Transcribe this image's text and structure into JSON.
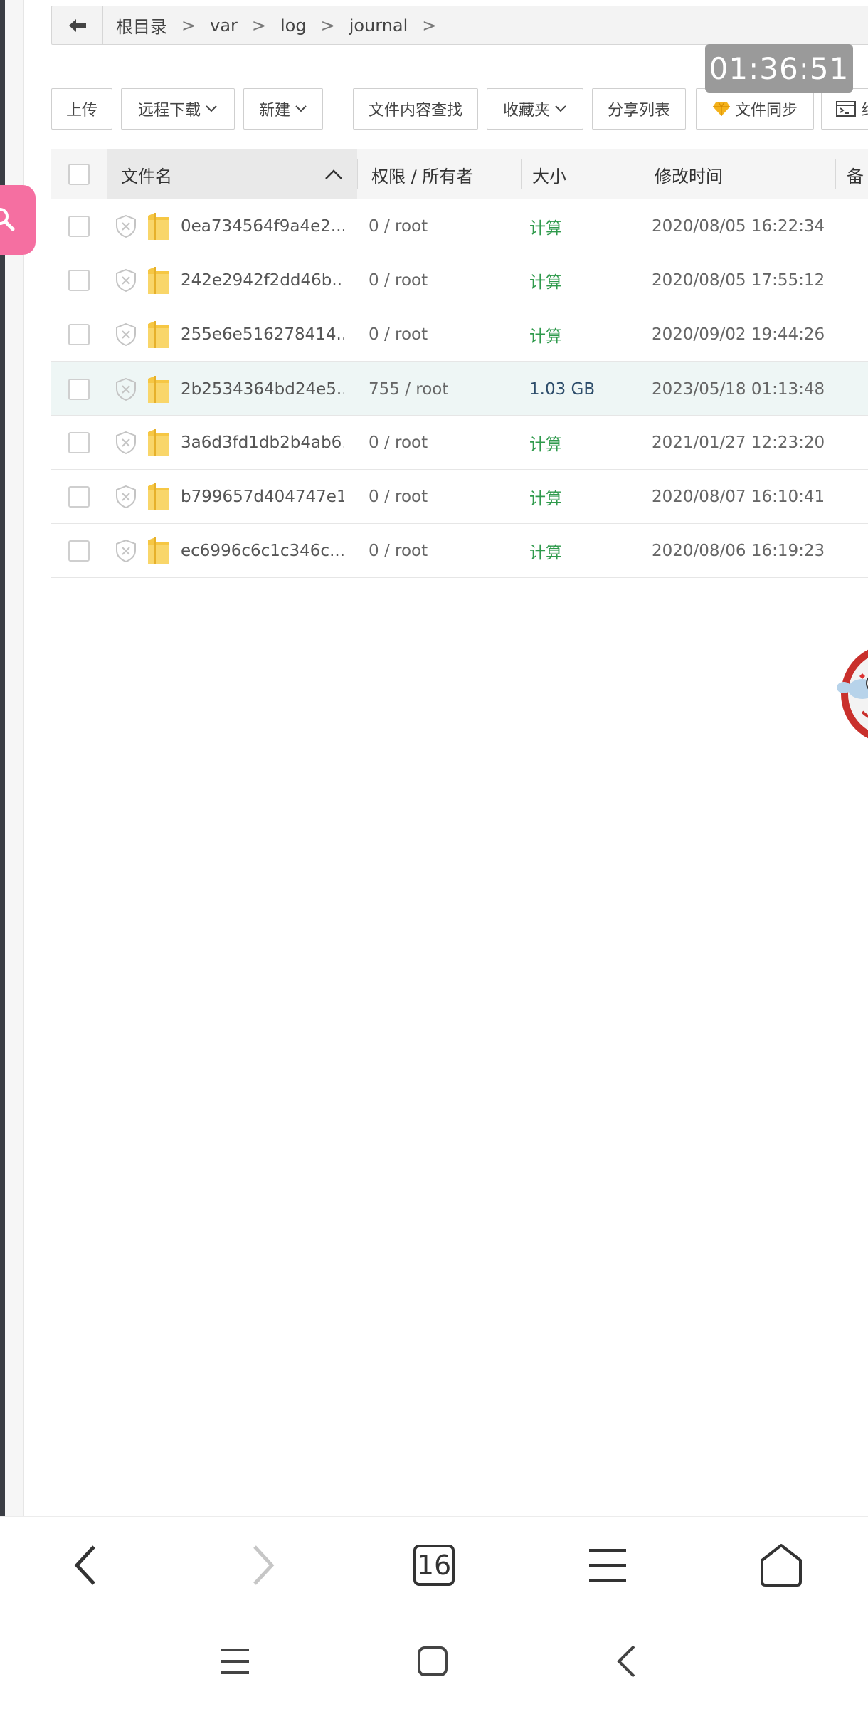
{
  "breadcrumb": {
    "items": [
      "根目录",
      "var",
      "log",
      "journal"
    ],
    "separator": ">"
  },
  "clock": "01:36:51",
  "toolbar": {
    "upload": "上传",
    "remote_download": "远程下载",
    "new": "新建",
    "content_search": "文件内容查找",
    "favorites": "收藏夹",
    "share_list": "分享列表",
    "file_sync": "文件同步",
    "terminal": "终端"
  },
  "table": {
    "headers": {
      "name": "文件名",
      "perm_owner": "权限 / 所有者",
      "size": "大小",
      "mtime": "修改时间",
      "remark": "备"
    },
    "rows": [
      {
        "name": "0ea734564f9a4e2...",
        "perm": "0 / root",
        "size": "计算",
        "mtime": "2020/08/05 16:22:34"
      },
      {
        "name": "242e2942f2dd46b...",
        "perm": "0 / root",
        "size": "计算",
        "mtime": "2020/08/05 17:55:12"
      },
      {
        "name": "255e6e516278414...",
        "perm": "0 / root",
        "size": "计算",
        "mtime": "2020/09/02 19:44:26"
      },
      {
        "name": "2b2534364bd24e5...",
        "perm": "755 / root",
        "size": "1.03 GB",
        "mtime": "2023/05/18 01:13:48"
      },
      {
        "name": "3a6d3fd1db2b4ab6...",
        "perm": "0 / root",
        "size": "计算",
        "mtime": "2021/01/27 12:23:20"
      },
      {
        "name": "b799657d404747e1...",
        "perm": "0 / root",
        "size": "计算",
        "mtime": "2020/08/07 16:10:41"
      },
      {
        "name": "ec6996c6c1c346c...",
        "perm": "0 / root",
        "size": "计算",
        "mtime": "2020/08/06 16:19:23"
      }
    ]
  },
  "browser_nav": {
    "tab_count": "16"
  },
  "icons": {
    "back": "arrow-left-icon",
    "folder": "folder-icon",
    "shield": "shield-icon",
    "diamond": "diamond-icon",
    "terminal": "terminal-icon",
    "search": "search-icon"
  },
  "colors": {
    "accent_green": "#2f9a4c",
    "pink": "#f56fa1",
    "folder_yellow": "#f6c744",
    "highlight_row": "#eef6f5"
  }
}
